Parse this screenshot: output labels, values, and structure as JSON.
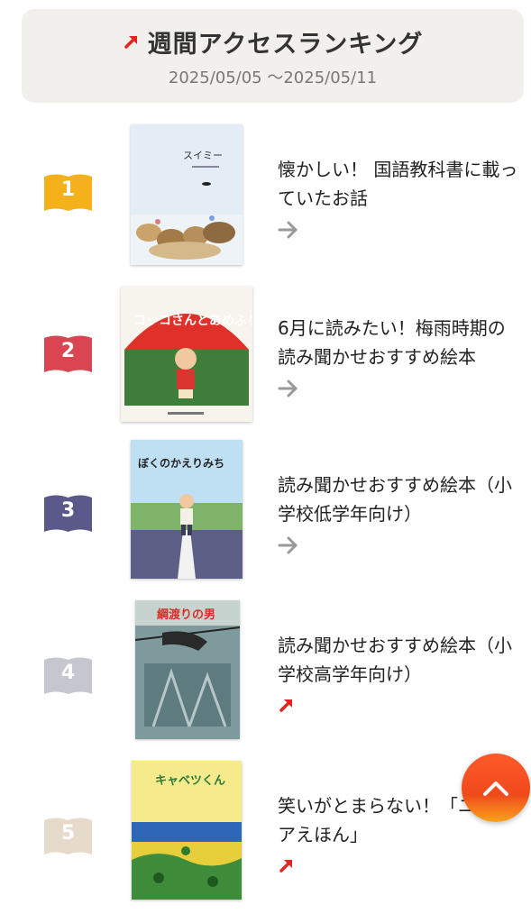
{
  "header": {
    "title": "週間アクセスランキング",
    "dates": "2025/05/05 ～2025/05/11",
    "trend_icon": "up-right-arrow-icon"
  },
  "colors": {
    "accent": "#e52420",
    "rank1": "#f4b11b",
    "rank2": "#d94550",
    "rank3": "#5b5989",
    "rank4": "#c6c6cf",
    "rank5": "#e6dbca"
  },
  "ranking": [
    {
      "rank": "1",
      "title": "懐かしい！ 国語教科書に載っていたお話",
      "trend": "right-arrow-icon",
      "cover_title": "スイミー"
    },
    {
      "rank": "2",
      "title": "6月に読みたい！梅雨時期の読み聞かせおすすめ絵本",
      "trend": "right-arrow-icon",
      "cover_title": "コッコさんとあめふり"
    },
    {
      "rank": "3",
      "title": "読み聞かせおすすめ絵本（小学校低学年向け）",
      "trend": "right-arrow-icon",
      "cover_title": "ぼくのかえりみち"
    },
    {
      "rank": "4",
      "title": "読み聞かせおすすめ絵本（小学校高学年向け）",
      "trend": "up-right-arrow-icon",
      "cover_title": "綱渡りの男"
    },
    {
      "rank": "5",
      "title": "笑いがとまらない！「ユーモアえほん」",
      "trend": "up-right-arrow-icon",
      "cover_title": "キャベツくん"
    }
  ],
  "scroll_top_icon": "chevron-up-icon"
}
